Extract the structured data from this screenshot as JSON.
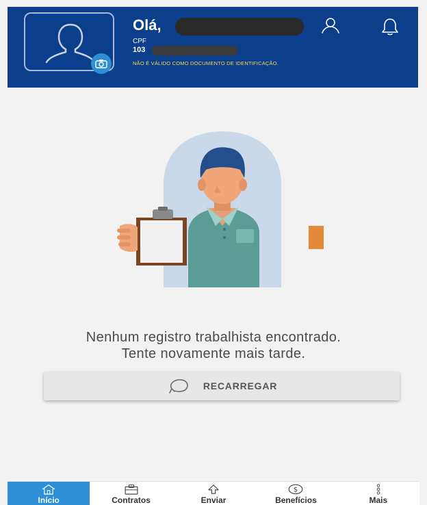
{
  "header": {
    "greeting": "Olá,",
    "cpf_label": "CPF",
    "cpf_prefix": "103",
    "warning": "NÃO É VÁLIDO COMO DOCUMENTO DE IDENTIFICAÇÃO.",
    "background_color": "#0b3f8c",
    "warning_color": "#ffd84d"
  },
  "main": {
    "message_line1": "Nenhum registro trabalhista encontrado.",
    "message_line2": "Tente novamente mais tarde.",
    "reload_label": "RECARREGAR"
  },
  "bottom_nav": {
    "active_color": "#2f8fd6",
    "items": [
      {
        "label": "Início",
        "icon": "home-icon",
        "active": true
      },
      {
        "label": "Contratos",
        "icon": "briefcase-icon",
        "active": false
      },
      {
        "label": "Enviar",
        "icon": "upload-icon",
        "active": false
      },
      {
        "label": "Benefícios",
        "icon": "dollar-icon",
        "active": false
      },
      {
        "label": "Mais",
        "icon": "more-vertical-icon",
        "active": false
      }
    ]
  }
}
